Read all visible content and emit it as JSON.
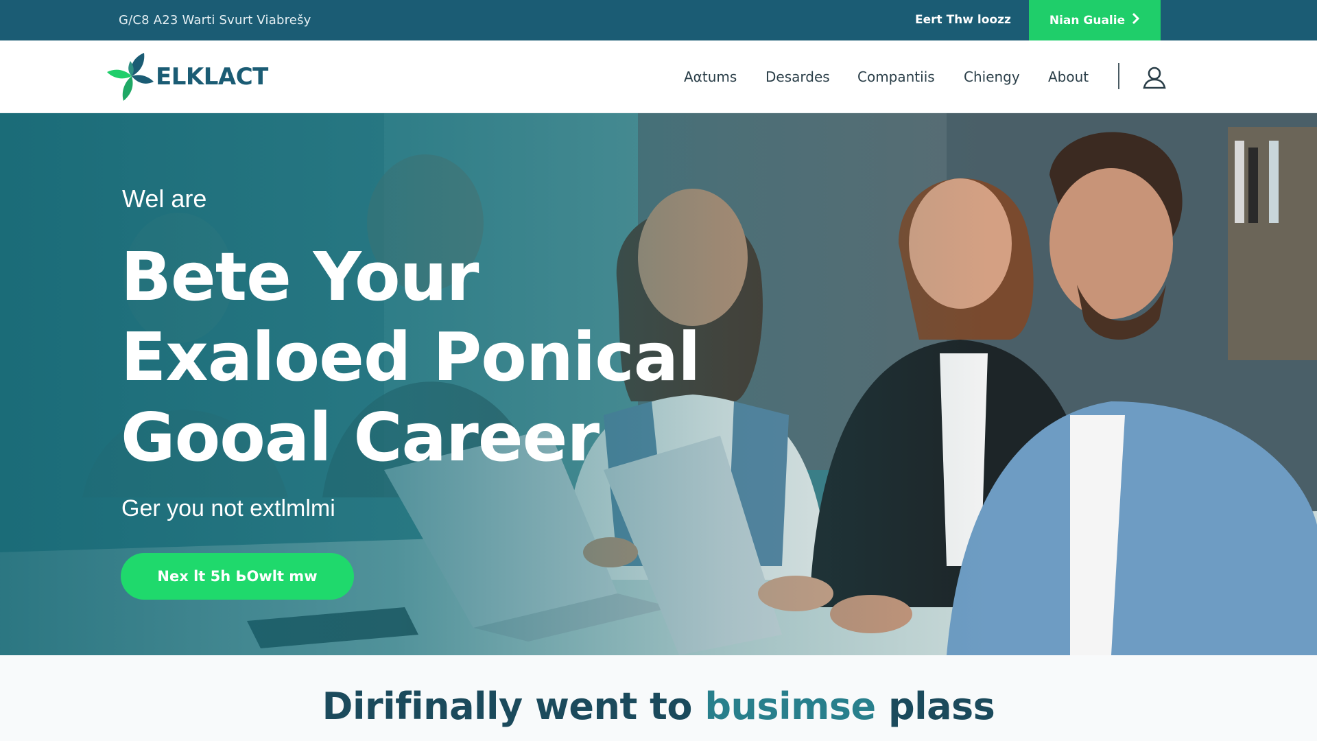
{
  "topbar": {
    "left_text": "G/C8 A23 Warti Svurt Viabrešy",
    "link_text": "Eert Thw loozz",
    "cta_label": "Nian Gualie",
    "cta_icon": "chevron-right-icon"
  },
  "navbar": {
    "brand": "ELKLACT",
    "logo_icon": "leaf-logo-icon",
    "items": [
      "Aαtums",
      "Desardes",
      "Compantiis",
      "Chiengy",
      "About"
    ],
    "user_icon": "user-icon"
  },
  "hero": {
    "eyebrow": "Wel are",
    "title_lines": [
      "Bete Your",
      "Exaloed Ponical",
      "Gooal Career"
    ],
    "subtitle": "Ger you not extlmlmi",
    "button_label": "Nex lt 5h ЬOwlt mw",
    "image_description": "four professionals smiling at laptops in an office"
  },
  "bottom": {
    "heading_start": "Dirifinally went to",
    "heading_accent": "busimse",
    "heading_end": "plass"
  },
  "colors": {
    "primary": "#1b5c74",
    "accent_green": "#1fce6a",
    "hero_teal": "#2a7f8c",
    "heading_dark": "#1b4a5c"
  }
}
